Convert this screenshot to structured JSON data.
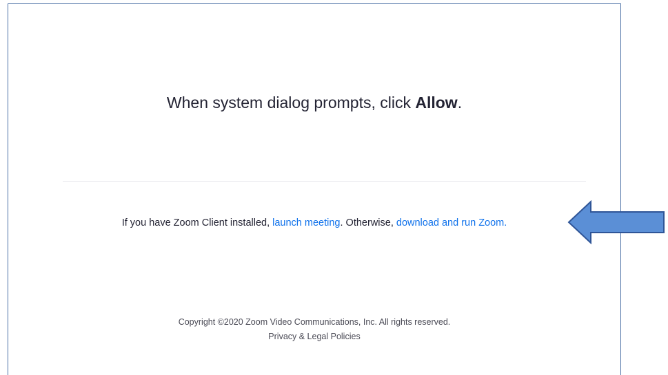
{
  "prompt": {
    "text_before": "When system dialog prompts, click ",
    "bold_word": "Allow",
    "text_after": "."
  },
  "launch": {
    "text_1": "If you have Zoom Client installed, ",
    "link_launch": "launch meeting",
    "text_2": ". Otherwise, ",
    "link_download": "download and run Zoom."
  },
  "footer": {
    "copyright": "Copyright ©2020 Zoom Video Communications, Inc. All rights reserved.",
    "privacy_link": "Privacy & Legal Policies"
  },
  "annotation": {
    "arrow_icon": "left-arrow-icon",
    "arrow_color": "#5b8fd6"
  },
  "colors": {
    "link": "#0e71eb",
    "text": "#232333",
    "frame_border": "#4a6fa5"
  }
}
